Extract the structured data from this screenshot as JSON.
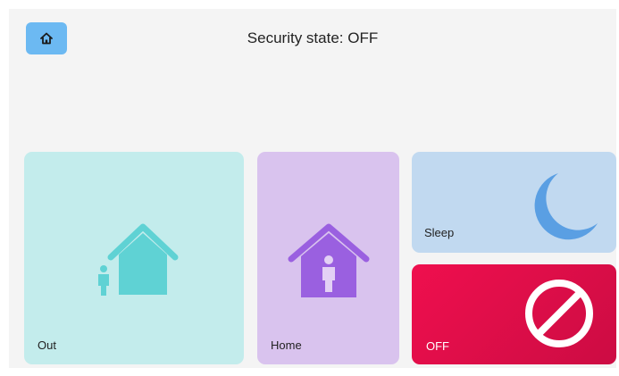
{
  "header": {
    "home_icon": "home-icon",
    "status_text": "Security state: OFF"
  },
  "modes": [
    {
      "label": "Out",
      "icon": "house-person-outside-icon",
      "color": "#c3ecec",
      "icon_color": "#5fd2d4"
    },
    {
      "label": "Home",
      "icon": "house-person-inside-icon",
      "color": "#d9c3ee",
      "icon_color": "#9a60e0"
    },
    {
      "label": "Sleep",
      "icon": "moon-icon",
      "color": "#c1d9f0",
      "icon_color": "#5a9fe3"
    },
    {
      "label": "OFF",
      "icon": "prohibited-icon",
      "color": "#e40d49",
      "icon_color": "#ffffff"
    }
  ],
  "colors": {
    "accent": "#6cb9f2",
    "background": "#f4f4f4"
  }
}
